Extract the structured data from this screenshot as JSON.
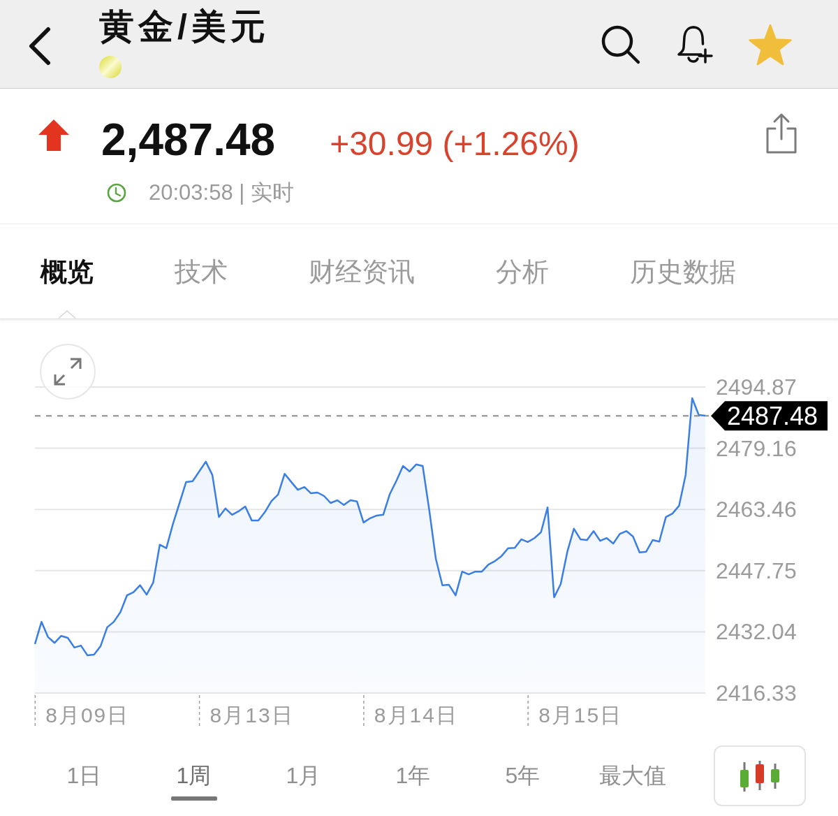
{
  "header": {
    "title": "黄金/美元"
  },
  "quote": {
    "price": "2,487.48",
    "change": "+30.99 (+1.26%)",
    "time": "20:03:58 | 实时"
  },
  "tabs": [
    {
      "label": "概览",
      "selected": true
    },
    {
      "label": "技术",
      "selected": false
    },
    {
      "label": "财经资讯",
      "selected": false
    },
    {
      "label": "分析",
      "selected": false
    },
    {
      "label": "历史数据",
      "selected": false
    }
  ],
  "chart": {
    "chart_data": {
      "type": "area",
      "grid": true,
      "categories": [
        null,
        null,
        null,
        null,
        null,
        null,
        null,
        null,
        "8月09日",
        null,
        null,
        null,
        null,
        null,
        null,
        null,
        null,
        null,
        null,
        null,
        null,
        null,
        null,
        null,
        null,
        null,
        null,
        null,
        null,
        null,
        null,
        null,
        null,
        "8月13日",
        null,
        null,
        null,
        null,
        null,
        null,
        null,
        null,
        null,
        null,
        null,
        null,
        null,
        null,
        null,
        null,
        null,
        null,
        null,
        null,
        null,
        null,
        null,
        null,
        "8月14日",
        null,
        null,
        null,
        null,
        null,
        null,
        null,
        null,
        null,
        null,
        null,
        null,
        null,
        null,
        null,
        null,
        null,
        null,
        null,
        null,
        null,
        null,
        null,
        null,
        "8月15日",
        null,
        null,
        null,
        null,
        null,
        null,
        null,
        null,
        null,
        null,
        null,
        null,
        null,
        null,
        null,
        null,
        null,
        null,
        null
      ],
      "series": [
        {
          "color": "#3a7ee4",
          "values": [
            2428.9,
            2434.6,
            2430.7,
            2429.2,
            2431.0,
            2430.5,
            2428.0,
            2428.5,
            2426.0,
            2426.2,
            2428.4,
            2433.2,
            2434.6,
            2437.1,
            2441.4,
            2442.2,
            2444.0,
            2441.6,
            2444.7,
            2454.4,
            2453.5,
            2459.7,
            2465.1,
            2470.5,
            2470.7,
            2473.2,
            2475.7,
            2472.3,
            2461.5,
            2463.7,
            2462.1,
            2463.0,
            2464.2,
            2460.6,
            2460.6,
            2462.8,
            2465.6,
            2467.3,
            2472.6,
            2470.5,
            2468.5,
            2469.2,
            2467.6,
            2467.8,
            2466.9,
            2465.1,
            2465.8,
            2464.6,
            2465.8,
            2465.5,
            2460.1,
            2461.2,
            2461.9,
            2462.1,
            2467.4,
            2470.8,
            2474.6,
            2473.2,
            2475.0,
            2474.6,
            2463.3,
            2450.8,
            2444.0,
            2444.1,
            2441.4,
            2447.5,
            2446.8,
            2447.5,
            2447.5,
            2449.3,
            2450.2,
            2451.5,
            2453.5,
            2453.6,
            2455.8,
            2455.1,
            2456.1,
            2457.6,
            2464.0,
            2440.9,
            2444.3,
            2452.6,
            2458.5,
            2455.8,
            2455.6,
            2457.9,
            2455.4,
            2456.1,
            2454.7,
            2457.2,
            2457.9,
            2456.5,
            2452.4,
            2452.6,
            2455.6,
            2455.2,
            2461.5,
            2462.4,
            2464.4,
            2472.3,
            2492.0,
            2487.7,
            2487.5
          ]
        }
      ],
      "ylim": [
        2416.33,
        2494.87
      ],
      "yticks": [
        2494.87,
        2479.16,
        2463.46,
        2447.75,
        2432.04,
        2416.33
      ],
      "ref_lines": [
        {
          "axis": "y",
          "value": 2487.48,
          "label": "2487.48"
        }
      ]
    }
  },
  "ranges": [
    {
      "label": "1日",
      "selected": false
    },
    {
      "label": "1周",
      "selected": true
    },
    {
      "label": "1月",
      "selected": false
    },
    {
      "label": "1年",
      "selected": false
    },
    {
      "label": "5年",
      "selected": false
    },
    {
      "label": "最大值",
      "selected": false
    }
  ]
}
